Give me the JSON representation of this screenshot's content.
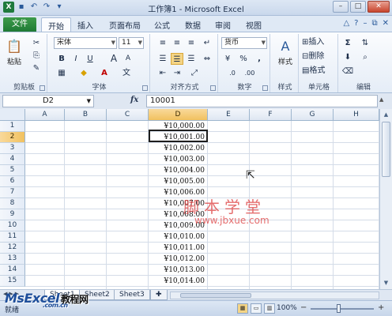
{
  "window": {
    "title": "工作簿1 - Microsoft Excel"
  },
  "ribbon_tabs": [
    "开始",
    "插入",
    "页面布局",
    "公式",
    "数据",
    "审阅",
    "视图"
  ],
  "file_tab": "文件",
  "clipboard": {
    "paste": "粘贴",
    "label": "剪贴板"
  },
  "font": {
    "name": "宋体",
    "size": "11",
    "label": "字体",
    "bold": "B",
    "italic": "I",
    "underline": "U",
    "grow": "A",
    "color_letter": "A"
  },
  "alignment": {
    "label": "对齐方式"
  },
  "number": {
    "format": "货币",
    "percent": "%",
    "comma": ",",
    "label": "数字"
  },
  "styles": {
    "label": "样式"
  },
  "cells": {
    "insert": "插入",
    "delete": "删除",
    "format": "格式",
    "label": "单元格"
  },
  "editing": {
    "label": "编辑",
    "sigma": "Σ"
  },
  "formula_bar": {
    "name_box": "D2",
    "fx": "fx",
    "value": "10001"
  },
  "columns": [
    "A",
    "B",
    "C",
    "D",
    "E",
    "F",
    "G",
    "H"
  ],
  "rows": [
    "1",
    "2",
    "3",
    "4",
    "5",
    "6",
    "7",
    "8",
    "9",
    "10",
    "11",
    "12",
    "13",
    "14",
    "15"
  ],
  "d_values": [
    "¥10,000.00",
    "¥10,001.00",
    "¥10,002.00",
    "¥10,003.00",
    "¥10,004.00",
    "¥10,005.00",
    "¥10,006.00",
    "¥10,007.00",
    "¥10,008.00",
    "¥10,009.00",
    "¥10,010.00",
    "¥10,011.00",
    "¥10,012.00",
    "¥10,013.00",
    "¥10,014.00"
  ],
  "sheets": [
    "Sheet1",
    "Sheet2",
    "Sheet3"
  ],
  "status": {
    "ready": "就绪",
    "zoom": "100%",
    "minus": "−",
    "plus": "+"
  },
  "watermark": {
    "line1": "脚本学堂",
    "line2": "www.jbxue.com"
  },
  "logo": {
    "brand": "MsExcel",
    "cn": "教程网",
    "sub": ".com.cn"
  },
  "colors": {
    "file_tab": "#1f7a35",
    "selected_header": "#f1c15f",
    "grid_line": "#d4dce8"
  }
}
